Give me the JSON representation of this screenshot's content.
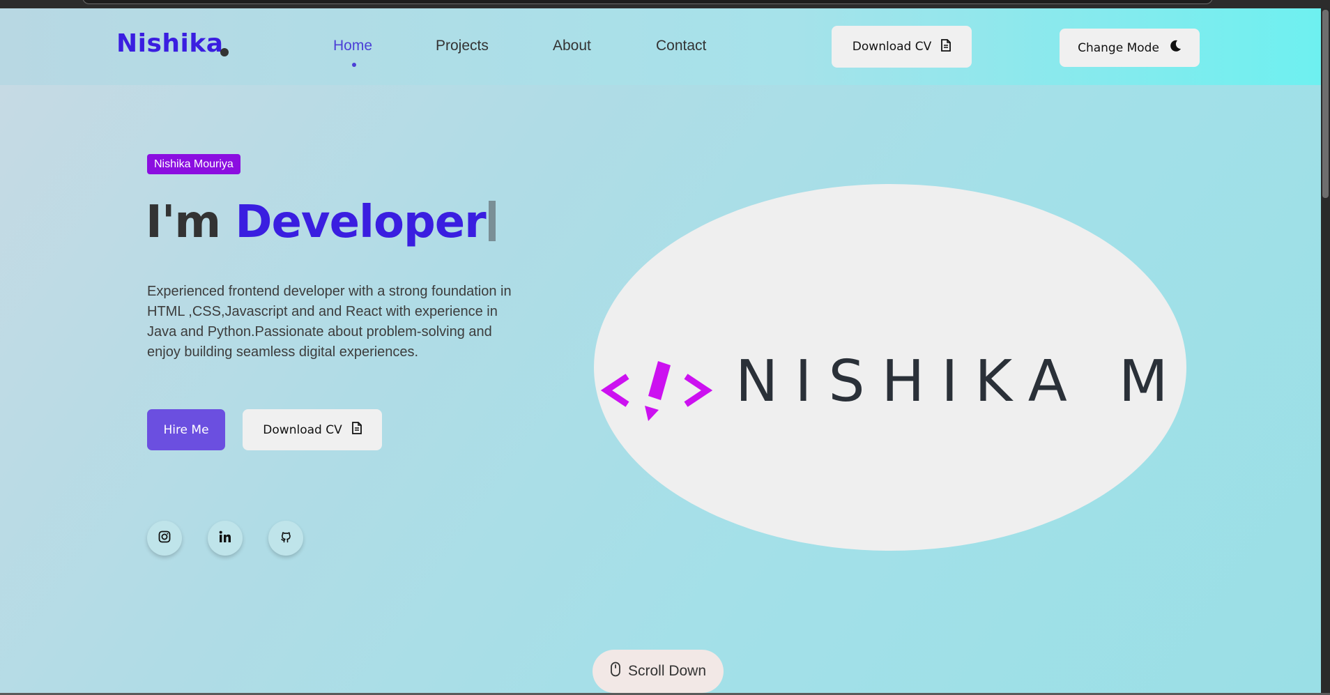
{
  "header": {
    "logo": "Nishika",
    "nav": [
      {
        "label": "Home",
        "active": true
      },
      {
        "label": "Projects",
        "active": false
      },
      {
        "label": "About",
        "active": false
      },
      {
        "label": "Contact",
        "active": false
      }
    ],
    "download_cv_label": "Download CV",
    "change_mode_label": "Change Mode"
  },
  "hero": {
    "badge": "Nishika Mouriya",
    "headline_prefix": "I'm ",
    "headline_accent": "Developer",
    "description": "Experienced frontend developer with a strong foundation in HTML ,CSS,Javascript and and React with experience in Java and Python.Passionate about problem-solving and enjoy building seamless digital experiences.",
    "hire_label": "Hire Me",
    "download_cv_label": "Download CV",
    "socials": [
      {
        "icon": "instagram-icon"
      },
      {
        "icon": "linkedin-icon"
      },
      {
        "icon": "github-icon"
      }
    ]
  },
  "brand_image": {
    "text": "NISHIKA M",
    "mark_color": "#cc11f0",
    "text_color": "#2a3038"
  },
  "scroll": {
    "label": "Scroll Down"
  },
  "colors": {
    "accent": "#3a1ee0",
    "hire_button": "#6b4fe0",
    "badge": "#8b0ee0"
  }
}
